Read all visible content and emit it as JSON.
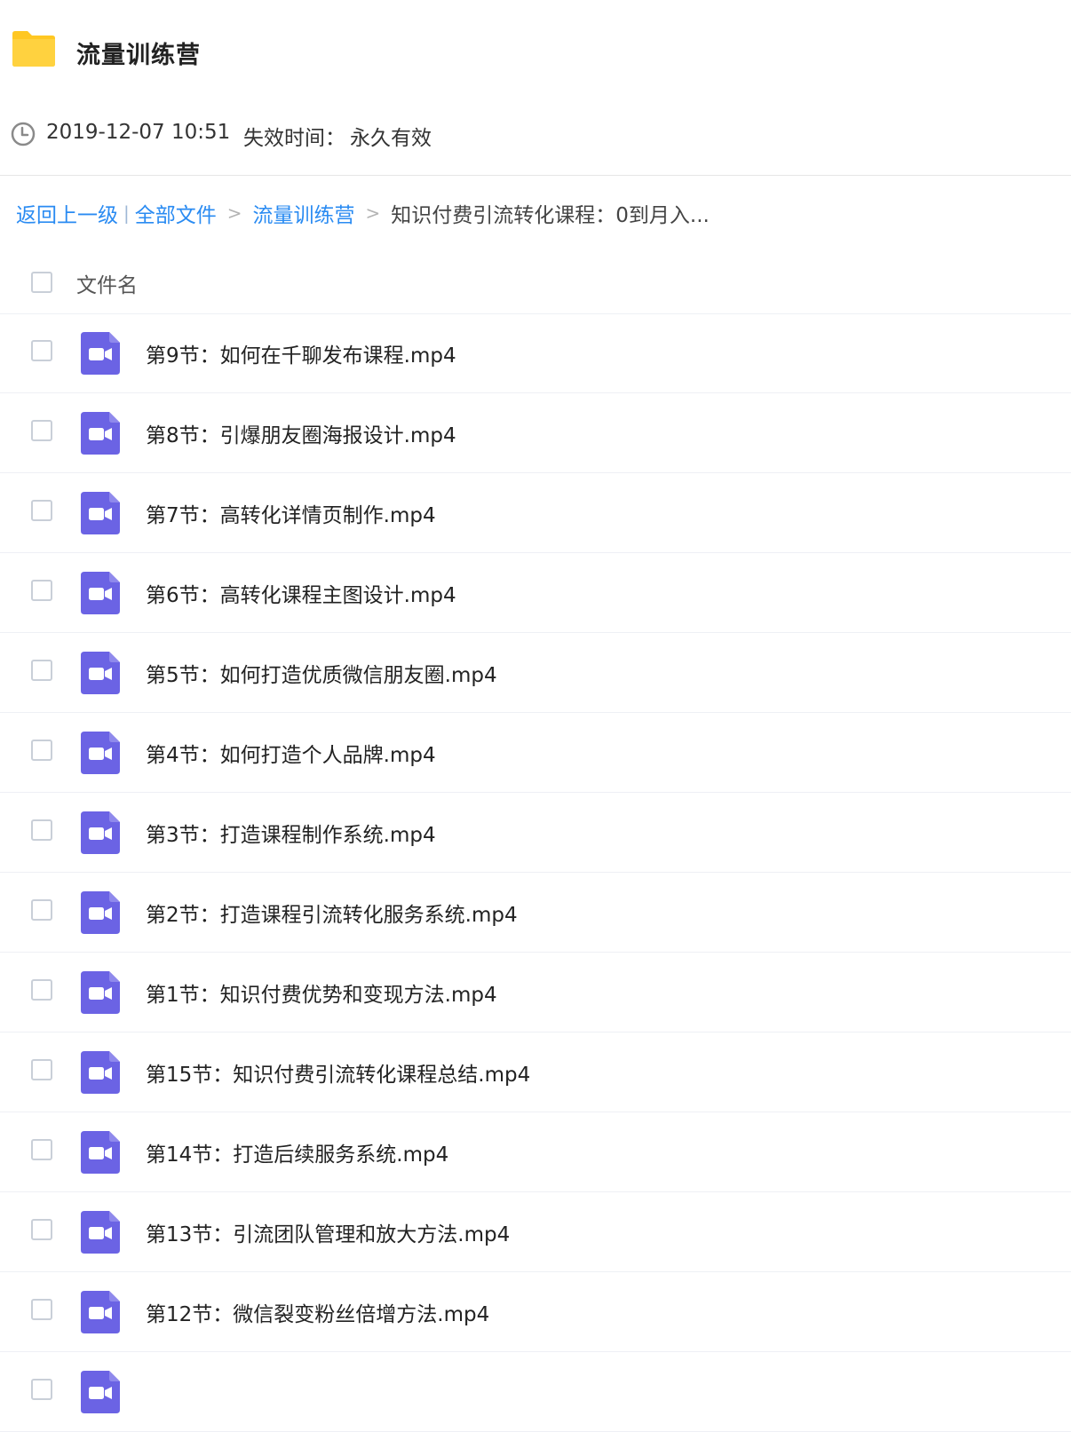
{
  "header": {
    "folder_icon": "folder-icon",
    "title": "流量训练营"
  },
  "meta": {
    "clock_icon": "clock-icon",
    "date": "2019-12-07 10:51",
    "expire_label": "失效时间：",
    "expire_value": "永久有效"
  },
  "breadcrumb": {
    "back": "返回上一级",
    "pipe": "|",
    "all_files": "全部文件",
    "sep": ">",
    "folder": "流量训练营",
    "current": "知识付费引流转化课程：0到月入..."
  },
  "list": {
    "column_label": "文件名",
    "file_icon": "video-file-icon",
    "colors": {
      "video_icon": "#6b63e4",
      "folder": "#ffc722",
      "link": "#2a8bf2"
    },
    "files": [
      {
        "name": "第9节：如何在千聊发布课程.mp4"
      },
      {
        "name": "第8节：引爆朋友圈海报设计.mp4"
      },
      {
        "name": "第7节：高转化详情页制作.mp4"
      },
      {
        "name": "第6节：高转化课程主图设计.mp4"
      },
      {
        "name": "第5节：如何打造优质微信朋友圈.mp4"
      },
      {
        "name": "第4节：如何打造个人品牌.mp4"
      },
      {
        "name": "第3节：打造课程制作系统.mp4"
      },
      {
        "name": "第2节：打造课程引流转化服务系统.mp4"
      },
      {
        "name": "第1节：知识付费优势和变现方法.mp4"
      },
      {
        "name": "第15节：知识付费引流转化课程总结.mp4"
      },
      {
        "name": "第14节：打造后续服务系统.mp4"
      },
      {
        "name": "第13节：引流团队管理和放大方法.mp4"
      },
      {
        "name": "第12节：微信裂变粉丝倍增方法.mp4"
      },
      {
        "name": ""
      }
    ]
  }
}
